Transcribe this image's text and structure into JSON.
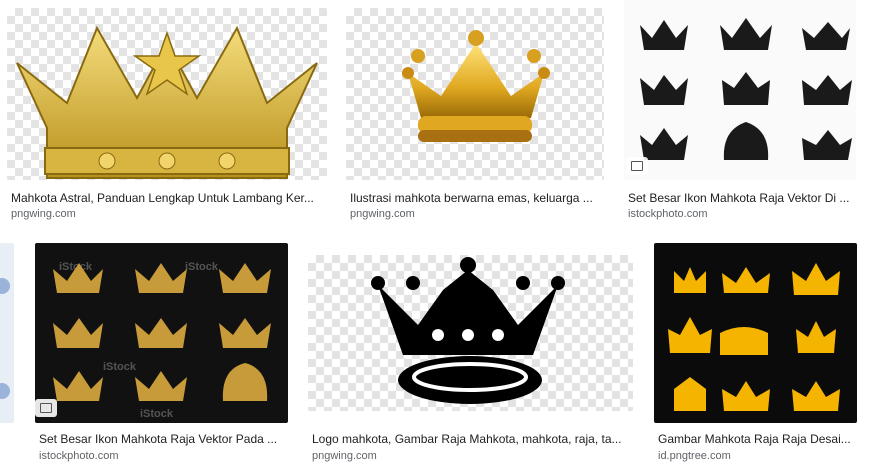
{
  "results": [
    {
      "title": "Mahkota Astral, Panduan Lengkap Untuk Lambang Ker...",
      "source": "pngwing.com"
    },
    {
      "title": "Ilustrasi mahkota berwarna emas, keluarga ...",
      "source": "pngwing.com"
    },
    {
      "title": "Set Besar Ikon Mahkota Raja Vektor Di ...",
      "source": "istockphoto.com"
    },
    {
      "title": "Set Besar Ikon Mahkota Raja Vektor Pada ...",
      "source": "istockphoto.com"
    },
    {
      "title": "Logo mahkota, Gambar Raja Mahkota, mahkota, raja, ta...",
      "source": "pngwing.com"
    },
    {
      "title": "Gambar Mahkota Raja Raja Desai...",
      "source": "id.pngtree.com"
    }
  ],
  "watermark": "iStock",
  "colors": {
    "gold": "#c9a227",
    "yellow": "#f5b400",
    "link_gray": "#5f6368"
  }
}
